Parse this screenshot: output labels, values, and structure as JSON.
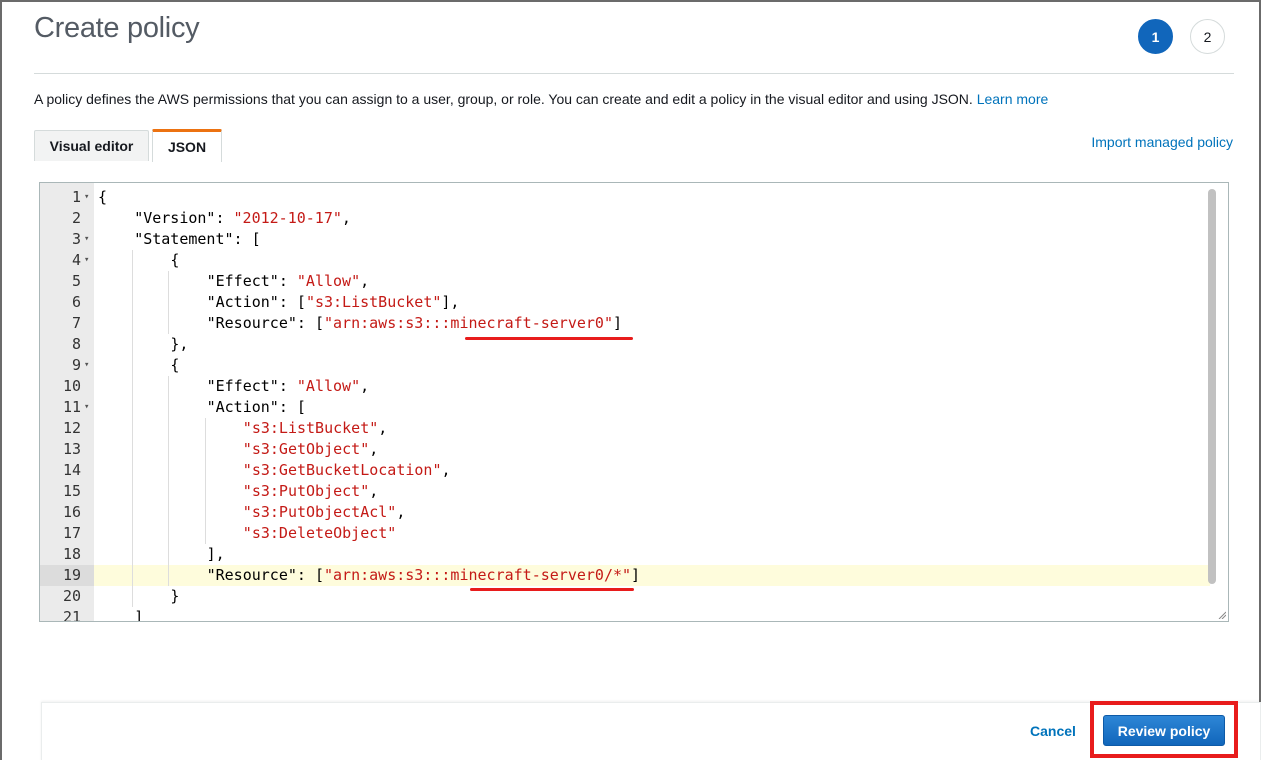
{
  "header": {
    "title": "Create policy",
    "steps": [
      "1",
      "2"
    ],
    "description": "A policy defines the AWS permissions that you can assign to a user, group, or role. You can create and edit a policy in the visual editor and using JSON.",
    "learn_more": "Learn more"
  },
  "tabs": [
    {
      "label": "Visual editor",
      "active": false
    },
    {
      "label": "JSON",
      "active": true
    }
  ],
  "import_link": "Import managed policy",
  "editor": {
    "active_line": 19,
    "lines": [
      {
        "n": "1",
        "fold": true,
        "indent": 0,
        "parts": [
          [
            "p",
            "{"
          ]
        ]
      },
      {
        "n": "2",
        "fold": false,
        "indent": 1,
        "parts": [
          [
            "p",
            "\"Version\": "
          ],
          [
            "s",
            "\"2012-10-17\""
          ],
          [
            "p",
            ","
          ]
        ]
      },
      {
        "n": "3",
        "fold": true,
        "indent": 1,
        "parts": [
          [
            "p",
            "\"Statement\": ["
          ]
        ]
      },
      {
        "n": "4",
        "fold": true,
        "indent": 2,
        "parts": [
          [
            "p",
            "{"
          ]
        ]
      },
      {
        "n": "5",
        "fold": false,
        "indent": 3,
        "parts": [
          [
            "p",
            "\"Effect\": "
          ],
          [
            "s",
            "\"Allow\""
          ],
          [
            "p",
            ","
          ]
        ]
      },
      {
        "n": "6",
        "fold": false,
        "indent": 3,
        "parts": [
          [
            "p",
            "\"Action\": ["
          ],
          [
            "s",
            "\"s3:ListBucket\""
          ],
          [
            "p",
            "],"
          ]
        ]
      },
      {
        "n": "7",
        "fold": false,
        "indent": 3,
        "parts": [
          [
            "p",
            "\"Resource\": ["
          ],
          [
            "s",
            "\"arn:aws:s3:::minecraft-server0\""
          ],
          [
            "p",
            "]"
          ]
        ]
      },
      {
        "n": "8",
        "fold": false,
        "indent": 2,
        "parts": [
          [
            "p",
            "},"
          ]
        ]
      },
      {
        "n": "9",
        "fold": true,
        "indent": 2,
        "parts": [
          [
            "p",
            "{"
          ]
        ]
      },
      {
        "n": "10",
        "fold": false,
        "indent": 3,
        "parts": [
          [
            "p",
            "\"Effect\": "
          ],
          [
            "s",
            "\"Allow\""
          ],
          [
            "p",
            ","
          ]
        ]
      },
      {
        "n": "11",
        "fold": true,
        "indent": 3,
        "parts": [
          [
            "p",
            "\"Action\": ["
          ]
        ]
      },
      {
        "n": "12",
        "fold": false,
        "indent": 4,
        "parts": [
          [
            "s",
            "\"s3:ListBucket\""
          ],
          [
            "p",
            ","
          ]
        ]
      },
      {
        "n": "13",
        "fold": false,
        "indent": 4,
        "parts": [
          [
            "s",
            "\"s3:GetObject\""
          ],
          [
            "p",
            ","
          ]
        ]
      },
      {
        "n": "14",
        "fold": false,
        "indent": 4,
        "parts": [
          [
            "s",
            "\"s3:GetBucketLocation\""
          ],
          [
            "p",
            ","
          ]
        ]
      },
      {
        "n": "15",
        "fold": false,
        "indent": 4,
        "parts": [
          [
            "s",
            "\"s3:PutObject\""
          ],
          [
            "p",
            ","
          ]
        ]
      },
      {
        "n": "16",
        "fold": false,
        "indent": 4,
        "parts": [
          [
            "s",
            "\"s3:PutObjectAcl\""
          ],
          [
            "p",
            ","
          ]
        ]
      },
      {
        "n": "17",
        "fold": false,
        "indent": 4,
        "parts": [
          [
            "s",
            "\"s3:DeleteObject\""
          ]
        ]
      },
      {
        "n": "18",
        "fold": false,
        "indent": 3,
        "parts": [
          [
            "p",
            "],"
          ]
        ]
      },
      {
        "n": "19",
        "fold": false,
        "indent": 3,
        "parts": [
          [
            "p",
            "\"Resource\": ["
          ],
          [
            "s",
            "\"arn:aws:s3:::minecraft-server0/*\""
          ],
          [
            "p",
            "]"
          ]
        ]
      },
      {
        "n": "20",
        "fold": false,
        "indent": 2,
        "parts": [
          [
            "p",
            "}"
          ]
        ]
      },
      {
        "n": "21",
        "fold": false,
        "indent": 1,
        "parts": [
          [
            "p",
            "]"
          ]
        ]
      }
    ]
  },
  "footer": {
    "cancel_label": "Cancel",
    "review_label": "Review policy"
  },
  "colors": {
    "primary": "#1166bb",
    "link": "#0073bb",
    "string": "#c41a16",
    "highlight_annotation": "#e81c1c",
    "active_tab_accent": "#ec7211"
  }
}
